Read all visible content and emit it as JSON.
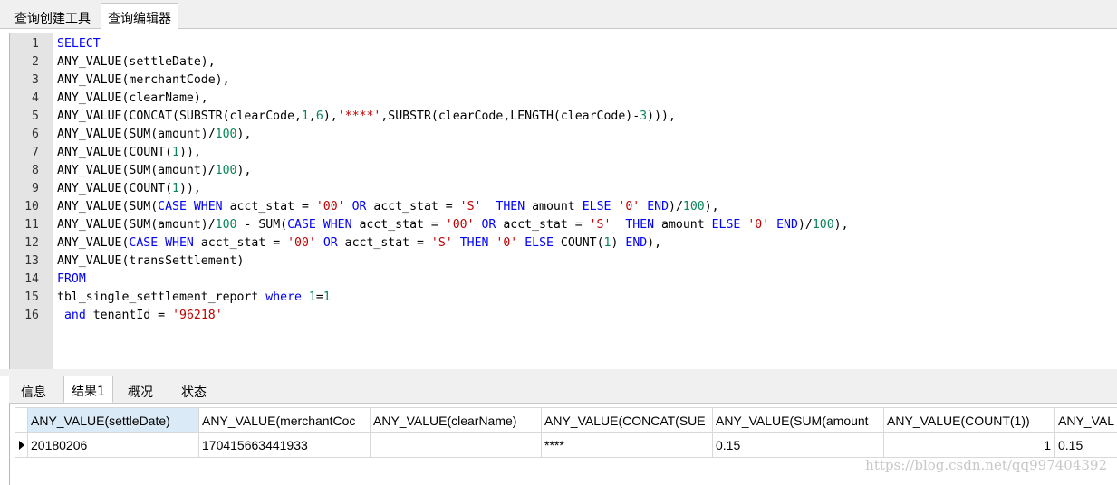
{
  "top_tabs": [
    "查询创建工具",
    "查询编辑器"
  ],
  "code_lines": [
    [
      {
        "t": "SELECT",
        "c": "kw"
      }
    ],
    [
      {
        "t": "ANY_VALUE(settleDate),",
        "c": ""
      }
    ],
    [
      {
        "t": "ANY_VALUE(merchantCode),",
        "c": ""
      }
    ],
    [
      {
        "t": "ANY_VALUE(clearName),",
        "c": ""
      }
    ],
    [
      {
        "t": "ANY_VALUE(CONCAT(SUBSTR(clearCode,",
        "c": ""
      },
      {
        "t": "1",
        "c": "num"
      },
      {
        "t": ",",
        "c": ""
      },
      {
        "t": "6",
        "c": "num"
      },
      {
        "t": "),",
        "c": ""
      },
      {
        "t": "'****'",
        "c": "str"
      },
      {
        "t": ",SUBSTR(clearCode,LENGTH(clearCode)-",
        "c": ""
      },
      {
        "t": "3",
        "c": "num"
      },
      {
        "t": "))),",
        "c": ""
      }
    ],
    [
      {
        "t": "ANY_VALUE(SUM(amount)/",
        "c": ""
      },
      {
        "t": "100",
        "c": "num"
      },
      {
        "t": "),",
        "c": ""
      }
    ],
    [
      {
        "t": "ANY_VALUE(COUNT(",
        "c": ""
      },
      {
        "t": "1",
        "c": "num"
      },
      {
        "t": ")),",
        "c": ""
      }
    ],
    [
      {
        "t": "ANY_VALUE(SUM(amount)/",
        "c": ""
      },
      {
        "t": "100",
        "c": "num"
      },
      {
        "t": "),",
        "c": ""
      }
    ],
    [
      {
        "t": "ANY_VALUE(COUNT(",
        "c": ""
      },
      {
        "t": "1",
        "c": "num"
      },
      {
        "t": ")),",
        "c": ""
      }
    ],
    [
      {
        "t": "ANY_VALUE(SUM(",
        "c": ""
      },
      {
        "t": "CASE WHEN",
        "c": "kw"
      },
      {
        "t": " acct_stat = ",
        "c": ""
      },
      {
        "t": "'00'",
        "c": "str"
      },
      {
        "t": " ",
        "c": ""
      },
      {
        "t": "OR",
        "c": "kw"
      },
      {
        "t": " acct_stat = ",
        "c": ""
      },
      {
        "t": "'S'",
        "c": "str"
      },
      {
        "t": "  ",
        "c": ""
      },
      {
        "t": "THEN",
        "c": "kw"
      },
      {
        "t": " amount ",
        "c": ""
      },
      {
        "t": "ELSE",
        "c": "kw"
      },
      {
        "t": " ",
        "c": ""
      },
      {
        "t": "'0'",
        "c": "str"
      },
      {
        "t": " ",
        "c": ""
      },
      {
        "t": "END",
        "c": "kw"
      },
      {
        "t": ")/",
        "c": ""
      },
      {
        "t": "100",
        "c": "num"
      },
      {
        "t": "),",
        "c": ""
      }
    ],
    [
      {
        "t": "ANY_VALUE(SUM(amount)/",
        "c": ""
      },
      {
        "t": "100",
        "c": "num"
      },
      {
        "t": " - SUM(",
        "c": ""
      },
      {
        "t": "CASE WHEN",
        "c": "kw"
      },
      {
        "t": " acct_stat = ",
        "c": ""
      },
      {
        "t": "'00'",
        "c": "str"
      },
      {
        "t": " ",
        "c": ""
      },
      {
        "t": "OR",
        "c": "kw"
      },
      {
        "t": " acct_stat = ",
        "c": ""
      },
      {
        "t": "'S'",
        "c": "str"
      },
      {
        "t": "  ",
        "c": ""
      },
      {
        "t": "THEN",
        "c": "kw"
      },
      {
        "t": " amount ",
        "c": ""
      },
      {
        "t": "ELSE",
        "c": "kw"
      },
      {
        "t": " ",
        "c": ""
      },
      {
        "t": "'0'",
        "c": "str"
      },
      {
        "t": " ",
        "c": ""
      },
      {
        "t": "END",
        "c": "kw"
      },
      {
        "t": ")/",
        "c": ""
      },
      {
        "t": "100",
        "c": "num"
      },
      {
        "t": "),",
        "c": ""
      }
    ],
    [
      {
        "t": "ANY_VALUE(",
        "c": ""
      },
      {
        "t": "CASE WHEN",
        "c": "kw"
      },
      {
        "t": " acct_stat = ",
        "c": ""
      },
      {
        "t": "'00'",
        "c": "str"
      },
      {
        "t": " ",
        "c": ""
      },
      {
        "t": "OR",
        "c": "kw"
      },
      {
        "t": " acct_stat = ",
        "c": ""
      },
      {
        "t": "'S'",
        "c": "str"
      },
      {
        "t": " ",
        "c": ""
      },
      {
        "t": "THEN",
        "c": "kw"
      },
      {
        "t": " ",
        "c": ""
      },
      {
        "t": "'0'",
        "c": "str"
      },
      {
        "t": " ",
        "c": ""
      },
      {
        "t": "ELSE",
        "c": "kw"
      },
      {
        "t": " COUNT(",
        "c": ""
      },
      {
        "t": "1",
        "c": "num"
      },
      {
        "t": ") ",
        "c": ""
      },
      {
        "t": "END",
        "c": "kw"
      },
      {
        "t": "),",
        "c": ""
      }
    ],
    [
      {
        "t": "ANY_VALUE(transSettlement)",
        "c": ""
      }
    ],
    [
      {
        "t": "FROM",
        "c": "kw"
      }
    ],
    [
      {
        "t": "tbl_single_settlement_report ",
        "c": ""
      },
      {
        "t": "where",
        "c": "kw"
      },
      {
        "t": " ",
        "c": ""
      },
      {
        "t": "1",
        "c": "num"
      },
      {
        "t": "=",
        "c": ""
      },
      {
        "t": "1",
        "c": "num"
      }
    ],
    [
      {
        "t": " ",
        "c": ""
      },
      {
        "t": "and",
        "c": "kw"
      },
      {
        "t": " tenantId = ",
        "c": ""
      },
      {
        "t": "'96218'",
        "c": "str"
      }
    ]
  ],
  "bottom_tabs": [
    "信息",
    "结果1",
    "概况",
    "状态"
  ],
  "result_columns": [
    "ANY_VALUE(settleDate)",
    "ANY_VALUE(merchantCoc",
    "ANY_VALUE(clearName)",
    "ANY_VALUE(CONCAT(SUE",
    "ANY_VALUE(SUM(amount",
    "ANY_VALUE(COUNT(1))",
    "ANY_VAL"
  ],
  "result_row": [
    "20180206",
    "170415663441933",
    "",
    "****",
    "0.15",
    "1",
    "0.15"
  ],
  "watermark": "https://blog.csdn.net/qq997404392",
  "colors": {
    "keyword": "#0000ff",
    "number": "#098658",
    "string": "#c00000",
    "selected_header": "#dbeaf7"
  }
}
